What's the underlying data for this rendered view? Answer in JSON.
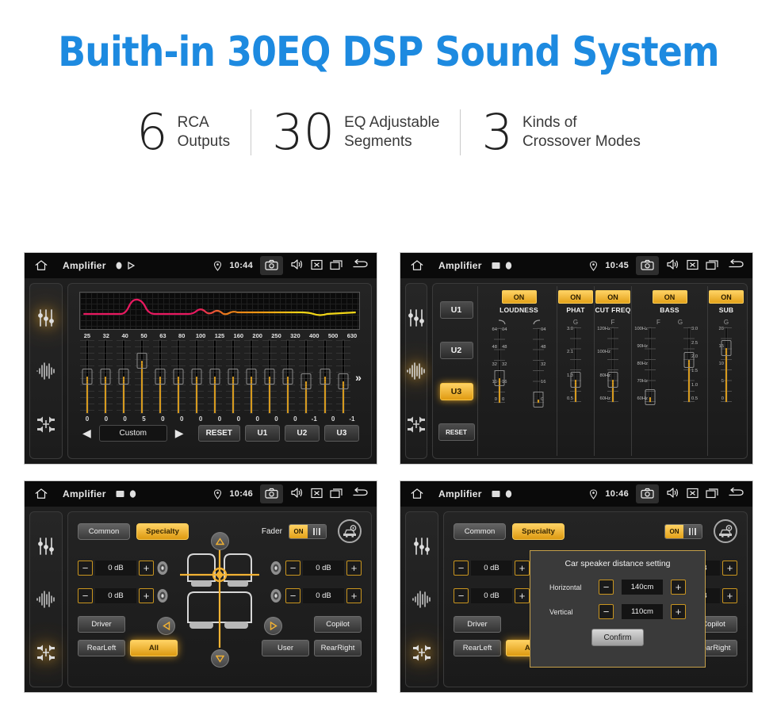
{
  "headline": "Buith-in 30EQ DSP Sound System",
  "stats": [
    {
      "number": "6",
      "line1": "RCA",
      "line2": "Outputs"
    },
    {
      "number": "30",
      "line1": "EQ Adjustable",
      "line2": "Segments"
    },
    {
      "number": "3",
      "line1": "Kinds of",
      "line2": "Crossover Modes"
    }
  ],
  "colors": {
    "headline": "#1d8ae0",
    "accent": "#e3a21a",
    "accent_glow": "#ffd264",
    "panel_bg": "#1b1b1b",
    "eq_fill": "#d79a1d",
    "curve_left": "#e8195f",
    "curve_mid": "#e87a1a",
    "curve_right": "#f2d617"
  },
  "statusbar": {
    "app_title": "Amplifier",
    "home_icon": "home-icon",
    "location_icon": "location-pin-icon",
    "camera_icon": "camera-icon",
    "volume_icon": "volume-icon",
    "close_icon": "close-box-icon",
    "recents_icon": "recents-icon",
    "back_icon": "back-arrow-icon",
    "mini_icons": [
      "record-dot-icon",
      "play-triangle-icon",
      "image-icon"
    ]
  },
  "rail": {
    "icons": [
      "equalizer-icon",
      "waveform-icon",
      "balance-icon"
    ]
  },
  "panel1": {
    "time": "10:44",
    "mini_icons": [
      "record-dot-icon",
      "play-triangle-icon"
    ],
    "active_rail": 0,
    "bands": [
      "25",
      "32",
      "40",
      "50",
      "63",
      "80",
      "100",
      "125",
      "160",
      "200",
      "250",
      "320",
      "400",
      "500",
      "630"
    ],
    "values": [
      "0",
      "0",
      "0",
      "5",
      "0",
      "0",
      "0",
      "0",
      "0",
      "0",
      "0",
      "0",
      "-1",
      "0",
      "-1"
    ],
    "knob_positions": [
      50,
      50,
      50,
      72,
      50,
      50,
      50,
      50,
      50,
      50,
      50,
      50,
      44,
      50,
      44
    ],
    "preset_label": "Custom",
    "prev_icon": "left-triangle-icon",
    "next_icon": "right-triangle-icon",
    "more_icon": "double-chevron-right-icon",
    "reset_label": "RESET",
    "user_presets": [
      "U1",
      "U2",
      "U3"
    ]
  },
  "panel2": {
    "time": "10:45",
    "active_rail": 1,
    "presets": [
      {
        "label": "U1",
        "active": false
      },
      {
        "label": "U2",
        "active": false
      },
      {
        "label": "U3",
        "active": true
      },
      {
        "label": "RESET",
        "active": false
      }
    ],
    "columns": [
      {
        "name": "LOUDNESS",
        "toggle": "ON",
        "sub_labels": [
          "curve-down-icon",
          "curve-up-icon"
        ],
        "faders": [
          {
            "scale_left": [
              "64",
              "48",
              "32",
              "16",
              "0"
            ],
            "scale_right": [
              "64",
              "48",
              "32",
              "16",
              "0"
            ],
            "value_pct": 33
          },
          {
            "scale_left": [],
            "scale_right": [
              "64",
              "48",
              "32",
              "16",
              "0"
            ],
            "value_pct": 4
          }
        ]
      },
      {
        "name": "PHAT",
        "toggle": "ON",
        "sub_labels": [
          "G"
        ],
        "faders": [
          {
            "scale_left": [
              "3.0",
              "2.1",
              "1.3",
              "0.5"
            ],
            "scale_right": [],
            "value_pct": 30
          }
        ]
      },
      {
        "name": "CUT FREQ",
        "toggle": "ON",
        "sub_labels": [
          "F"
        ],
        "faders": [
          {
            "scale_left": [
              "120Hz",
              "100Hz",
              "80Hz",
              "60Hz"
            ],
            "scale_right": [],
            "value_pct": 30
          }
        ]
      },
      {
        "name": "BASS",
        "toggle": "ON",
        "sub_labels": [
          "F",
          "G"
        ],
        "faders": [
          {
            "scale_left": [
              "100Hz",
              "90Hz",
              "80Hz",
              "70Hz",
              "60Hz"
            ],
            "scale_right": [],
            "value_pct": 6
          },
          {
            "scale_left": [],
            "scale_right": [
              "3.0",
              "2.5",
              "2.0",
              "1.5",
              "1.0",
              "0.5"
            ],
            "value_pct": 56
          }
        ]
      },
      {
        "name": "SUB",
        "toggle": "ON",
        "sub_labels": [
          "G"
        ],
        "faders": [
          {
            "scale_left": [
              "20",
              "15",
              "10",
              "5",
              "0"
            ],
            "scale_right": [],
            "value_pct": 72
          }
        ]
      }
    ]
  },
  "panel3": {
    "time": "10:46",
    "active_rail": 2,
    "tabs": [
      {
        "label": "Common",
        "active": false
      },
      {
        "label": "Specialty",
        "active": true
      }
    ],
    "fader_label": "Fader",
    "fader_toggle": "ON",
    "car_settings_icon": "car-settings-icon",
    "speakers": [
      {
        "position": "front-left",
        "value": "0 dB",
        "minus": "−",
        "plus": "+"
      },
      {
        "position": "rear-left",
        "value": "0 dB",
        "minus": "−",
        "plus": "+"
      },
      {
        "position": "front-right",
        "value": "0 dB",
        "minus": "−",
        "plus": "+"
      },
      {
        "position": "rear-right",
        "value": "0 dB",
        "minus": "−",
        "plus": "+"
      }
    ],
    "nav_icons": [
      "up-triangle-icon",
      "down-triangle-icon",
      "left-triangle-icon",
      "right-triangle-icon"
    ],
    "seat_buttons": [
      {
        "label": "Driver",
        "active": false
      },
      {
        "label": "Copilot",
        "active": false
      },
      {
        "label": "RearLeft",
        "active": false
      },
      {
        "label": "All",
        "active": true
      },
      {
        "label": "User",
        "active": false
      },
      {
        "label": "RearRight",
        "active": false
      }
    ]
  },
  "panel4": {
    "time": "10:46",
    "active_rail": 2,
    "dialog": {
      "title": "Car speaker distance setting",
      "rows": [
        {
          "label": "Horizontal",
          "value": "140cm",
          "minus": "−",
          "plus": "+"
        },
        {
          "label": "Vertical",
          "value": "110cm",
          "minus": "−",
          "plus": "+"
        }
      ],
      "confirm_label": "Confirm"
    }
  }
}
